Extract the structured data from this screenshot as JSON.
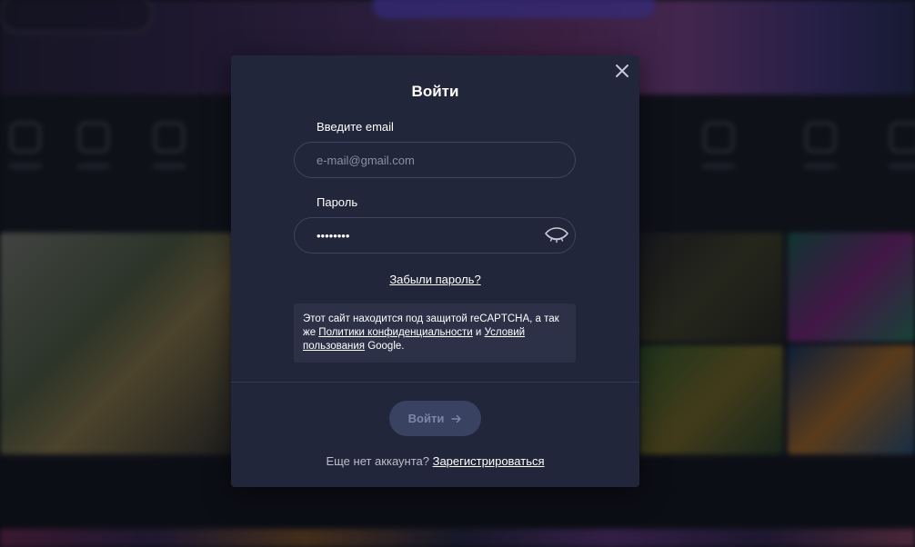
{
  "modal": {
    "title": "Войти",
    "email": {
      "label": "Введите email",
      "placeholder": "e-mail@gmail.com",
      "value": ""
    },
    "password": {
      "label": "Пароль",
      "value": "********"
    },
    "forgot_link": "Забыли пароль?",
    "recaptcha": {
      "text_before": "Этот сайт находится под защитой reCAPTCHA, а так же ",
      "privacy_link": "Политики конфиденциальности",
      "and": " и ",
      "terms_link": "Условий пользования",
      "text_after": " Google."
    },
    "submit_label": "Войти",
    "footer": {
      "question": "Еще нет аккаунта? ",
      "register_link": "Зарегистрироваться"
    }
  },
  "icons": {
    "close": "close-icon",
    "eye": "eye-closed-icon",
    "submit_arrow": "arrow-right-icon"
  },
  "colors": {
    "modal_bg": "#22263a",
    "input_border": "#3e4460",
    "button_bg": "#3a4262",
    "button_text": "#7d86a6",
    "recaptcha_bg": "#2c3148"
  }
}
